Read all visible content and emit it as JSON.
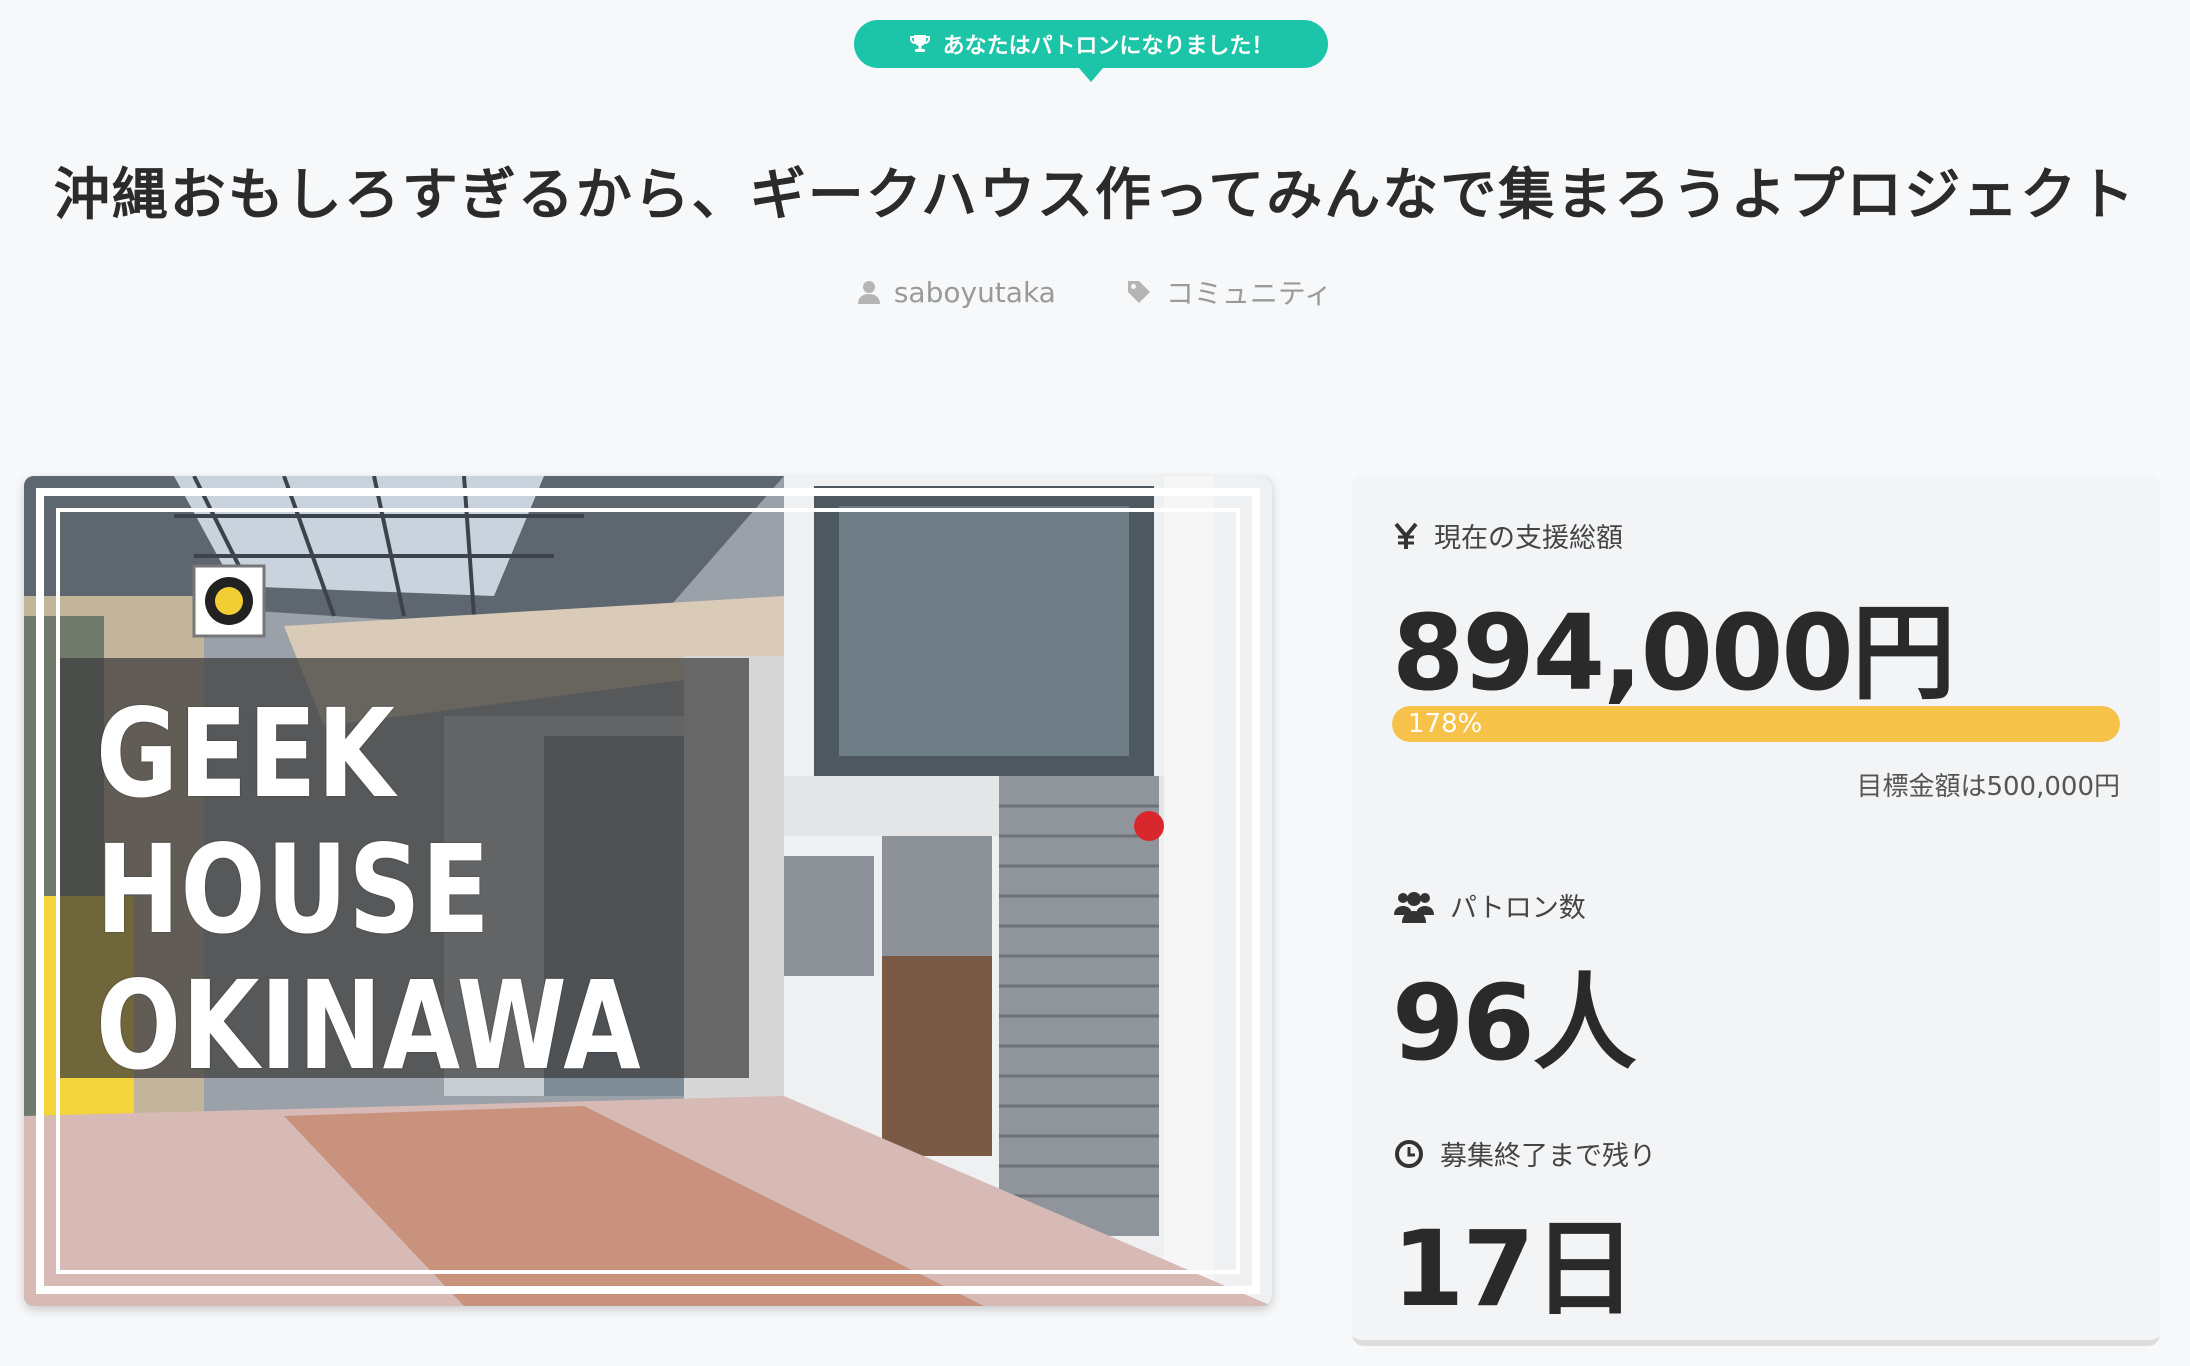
{
  "badge": {
    "icon": "trophy-icon",
    "text": "あなたはパトロンになりました！"
  },
  "project": {
    "title": "沖縄おもしろすぎるから、ギークハウス作ってみんなで集まろうよプロジェクト",
    "author": "saboyutaka",
    "category": "コミュニティ"
  },
  "hero": {
    "lines": [
      "GEEK",
      "HOUSE",
      "OKINAWA"
    ]
  },
  "stats": {
    "total": {
      "icon": "yen-icon",
      "label": "現在の支援総額",
      "value": "894,000円"
    },
    "progress": {
      "text": "178%",
      "percent": 178,
      "color": "#f7c24a"
    },
    "goal": "目標金額は500,000円",
    "patrons": {
      "icon": "users-icon",
      "label": "パトロン数",
      "value": "96人"
    },
    "remaining": {
      "icon": "clock-icon",
      "label": "募集終了まで残り",
      "value": "17日"
    }
  },
  "colors": {
    "accent": "#1cc5a8",
    "background": "#f6f8fa"
  }
}
